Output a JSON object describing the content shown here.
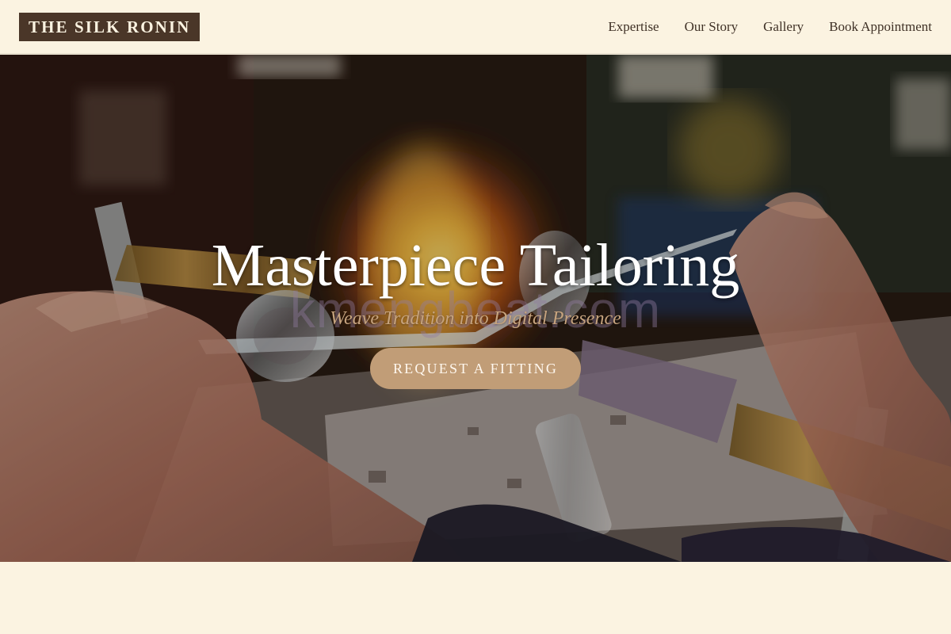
{
  "brand": {
    "name": "THE SILK RONIN"
  },
  "nav": {
    "items": [
      {
        "label": "Expertise"
      },
      {
        "label": "Our Story"
      },
      {
        "label": "Gallery"
      },
      {
        "label": "Book Appointment"
      }
    ]
  },
  "hero": {
    "title": "Masterpiece Tailoring",
    "subtitle": "Weave Tradition into Digital Presence",
    "cta_label": "REQUEST A FITTING",
    "watermark": "kmengbeat.com",
    "image_subject": "glassblowing-workbench-with-torch-flame-and-hands"
  },
  "colors": {
    "background": "#fbf3e1",
    "logo_background": "#4a3628",
    "logo_text": "#fbf3e1",
    "nav_text": "#3f3126",
    "accent": "#c19d77",
    "subtitle": "#c6a37e",
    "hero_text": "#ffffff"
  }
}
